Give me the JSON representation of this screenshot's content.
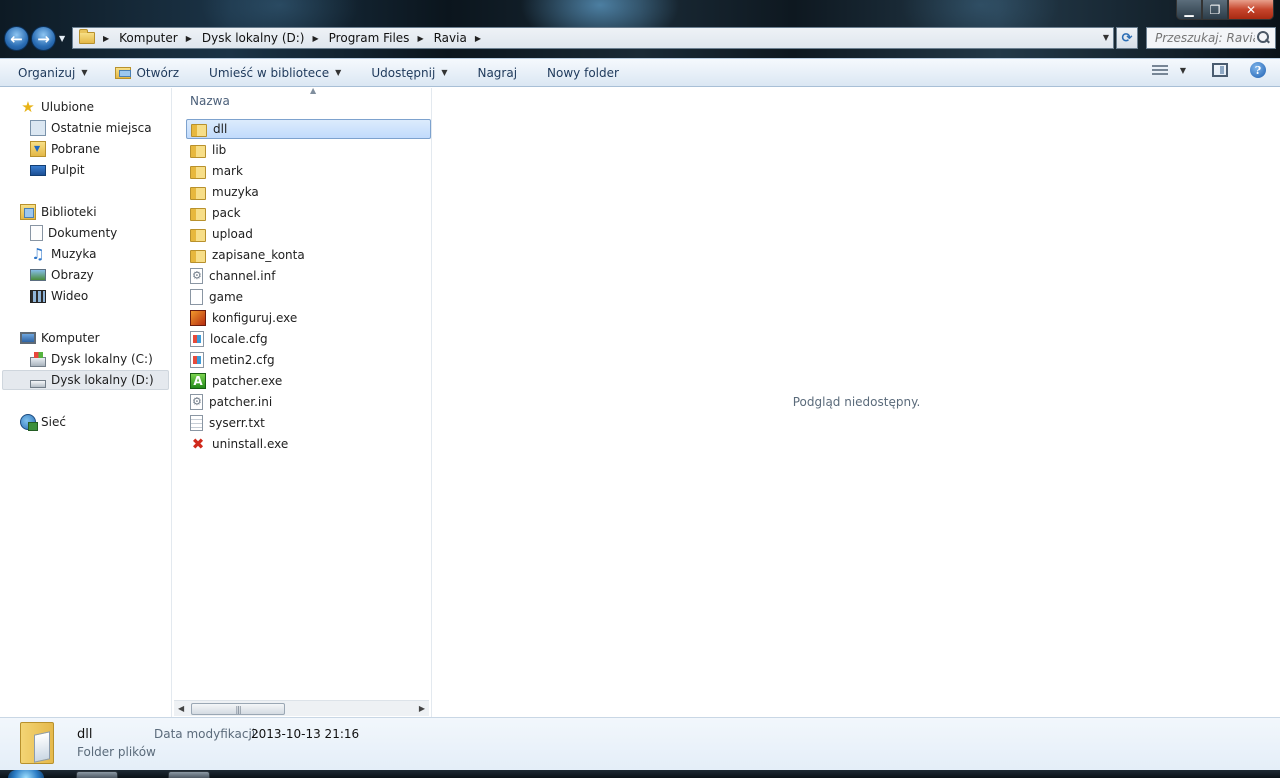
{
  "window": {
    "controls": {
      "minimize": "▁",
      "maximize": "❐",
      "close": "✕"
    }
  },
  "navigation": {
    "back": "←",
    "forward": "→",
    "history": "▼",
    "refresh": "⟳"
  },
  "address": {
    "sep": "▶",
    "crumbs": [
      "Komputer",
      "Dysk lokalny (D:)",
      "Program Files",
      "Ravia"
    ],
    "dropdown": "▼"
  },
  "search": {
    "placeholder": "Przeszukaj: Ravia"
  },
  "toolbar": {
    "organize": "Organizuj",
    "open": "Otwórz",
    "include_in_library": "Umieść w bibliotece",
    "share": "Udostępnij",
    "burn": "Nagraj",
    "new_folder": "Nowy folder",
    "arrow": "▼",
    "help": "?"
  },
  "sidebar": {
    "favorites": {
      "label": "Ulubione",
      "items": [
        "Ostatnie miejsca",
        "Pobrane",
        "Pulpit"
      ]
    },
    "libraries": {
      "label": "Biblioteki",
      "items": [
        "Dokumenty",
        "Muzyka",
        "Obrazy",
        "Wideo"
      ]
    },
    "computer": {
      "label": "Komputer",
      "items": [
        "Dysk lokalny (C:)",
        "Dysk lokalny (D:)"
      ],
      "selected": "Dysk lokalny (D:)"
    },
    "network": {
      "label": "Sieć"
    }
  },
  "file_list": {
    "column_name": "Nazwa",
    "sort_indicator": "▲",
    "items": [
      {
        "name": "dll",
        "icon": "folder-icon",
        "selected": true
      },
      {
        "name": "lib",
        "icon": "folder-icon"
      },
      {
        "name": "mark",
        "icon": "folder-icon"
      },
      {
        "name": "muzyka",
        "icon": "folder-icon"
      },
      {
        "name": "pack",
        "icon": "folder-icon"
      },
      {
        "name": "upload",
        "icon": "folder-icon"
      },
      {
        "name": "zapisane_konta",
        "icon": "folder-icon"
      },
      {
        "name": "channel.inf",
        "icon": "settings-file-icon"
      },
      {
        "name": "game",
        "icon": "blank-file-icon"
      },
      {
        "name": "konfiguruj.exe",
        "icon": "konfiguruj-app-icon"
      },
      {
        "name": "locale.cfg",
        "icon": "cfg-file-icon"
      },
      {
        "name": "metin2.cfg",
        "icon": "cfg-file-icon"
      },
      {
        "name": "patcher.exe",
        "icon": "patcher-app-icon"
      },
      {
        "name": "patcher.ini",
        "icon": "settings-file-icon"
      },
      {
        "name": "syserr.txt",
        "icon": "text-file-icon"
      },
      {
        "name": "uninstall.exe",
        "icon": "uninstall-app-icon"
      }
    ],
    "scroll": {
      "left": "◀",
      "right": "▶",
      "grip": "|||"
    }
  },
  "preview": {
    "message": "Podgląd niedostępny."
  },
  "details": {
    "name": "dll",
    "type": "Folder plików",
    "date_label": "Data modyfikacji:",
    "date_value": "2013-10-13 21:16"
  }
}
